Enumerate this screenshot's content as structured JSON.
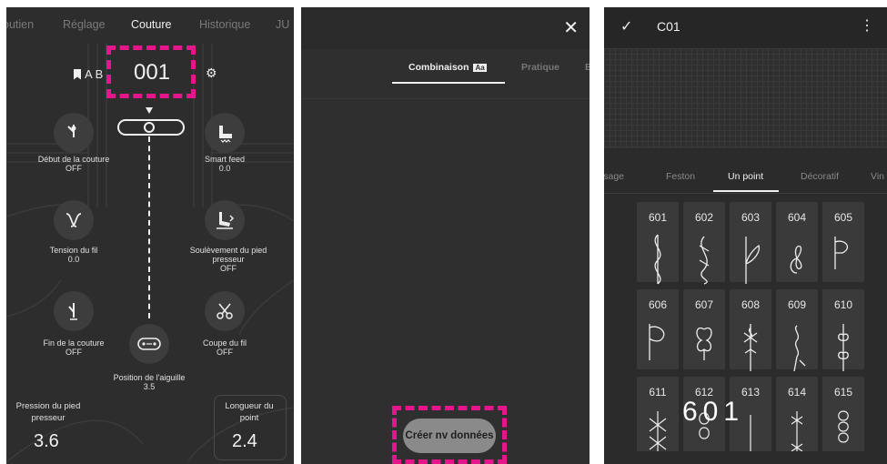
{
  "panel1": {
    "tabs": [
      {
        "label": "outien",
        "active": false
      },
      {
        "label": "Réglage",
        "active": false
      },
      {
        "label": "Couture",
        "active": true
      },
      {
        "label": "Historique",
        "active": false
      },
      {
        "label": "JU",
        "active": false
      }
    ],
    "pattern_label": "A B",
    "stitch_number": "001",
    "start_seam": {
      "label": "Début de la couture",
      "value": "OFF"
    },
    "smart_feed": {
      "label": "Smart feed",
      "value": "0.0"
    },
    "thread_tension": {
      "label": "Tension du fil",
      "value": "0.0"
    },
    "foot_lift": {
      "label": "Soulèvement du pied presseur",
      "value": "OFF"
    },
    "end_seam": {
      "label": "Fin de la couture",
      "value": "OFF"
    },
    "thread_cut": {
      "label": "Coupe du fil",
      "value": "OFF"
    },
    "needle_position": {
      "label": "Position de l'aiguille",
      "value": "3.5"
    },
    "foot_pressure": {
      "label": "Pression du pied presseur",
      "value": "3.6"
    },
    "stitch_length": {
      "label": "Longueur du point",
      "value": "2.4"
    }
  },
  "panel2": {
    "tabs": [
      {
        "label": "Combinaison",
        "active": true
      },
      {
        "label": "Pratique",
        "active": false
      },
      {
        "label": "B",
        "active": false
      }
    ],
    "combo_badge": "Aa",
    "new_data_button": "Créer nv données"
  },
  "panel3": {
    "title": "C01",
    "tabs": [
      {
        "label": "ssage",
        "active": false
      },
      {
        "label": "Feston",
        "active": false
      },
      {
        "label": "Un point",
        "active": true
      },
      {
        "label": "Décoratif",
        "active": false
      },
      {
        "label": "Vin",
        "active": false
      }
    ],
    "stitches": [
      "601",
      "602",
      "603",
      "604",
      "605",
      "606",
      "607",
      "608",
      "609",
      "610",
      "611",
      "612",
      "613",
      "614",
      "615"
    ],
    "selected_display": "601"
  },
  "colors": {
    "highlight": "#e5158c",
    "panel_bg": "#2d2d2d"
  }
}
